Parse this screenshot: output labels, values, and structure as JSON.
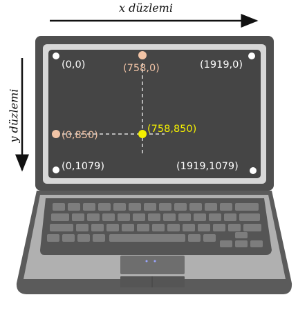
{
  "axes": {
    "x_title": "x düzlemi",
    "y_title": "y düzlemi"
  },
  "screen": {
    "corners": {
      "top_left": "(0,0)",
      "top_right": "(1919,0)",
      "bottom_left": "(0,1079)",
      "bottom_right": "(1919,1079)"
    },
    "projections": {
      "x_axis": "(758,0)",
      "y_axis": "(0,850)"
    },
    "highlight_point": "(758,850)"
  },
  "colors": {
    "corner_text": "#ffffff",
    "corner_dot": "#ffffff",
    "projection_text": "#f2c4a6",
    "projection_dot": "#f2c4a6",
    "highlight": "#f5f000",
    "screen_bg": "#454545",
    "bezel": "#5a5a5a",
    "laptop_body": "#a9a9a9"
  }
}
